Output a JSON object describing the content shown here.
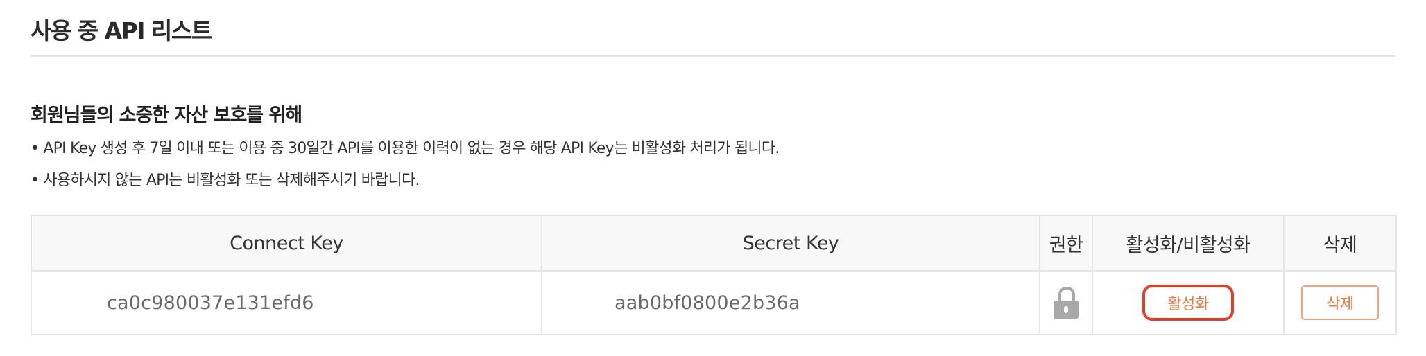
{
  "section_title": "사용 중 API 리스트",
  "notice": {
    "title": "회원님들의 소중한 자산 보호를 위해",
    "lines": [
      "• API Key 생성 후 7일 이내 또는 이용 중 30일간 API를 이용한 이력이 없는 경우 해당 API Key는 비활성화 처리가 됩니다.",
      "• 사용하시지 않는 API는 비활성화 또는 삭제해주시기 바랍니다."
    ]
  },
  "table": {
    "headers": [
      "Connect Key",
      "Secret Key",
      "권한",
      "활성화/비활성화",
      "삭제"
    ],
    "rows": [
      {
        "connect_key": "ca0c980037e131efd6",
        "secret_key": "aab0bf0800e2b36a",
        "permission_icon": "lock-icon",
        "activate_label": "활성화",
        "delete_label": "삭제"
      }
    ]
  },
  "colors": {
    "accent_orange": "#f07b3c",
    "highlight_red": "#e63b24",
    "border_gray": "#e6e6e6",
    "header_bg": "#f8f8f8",
    "lock_gray": "#a8a8a8"
  }
}
